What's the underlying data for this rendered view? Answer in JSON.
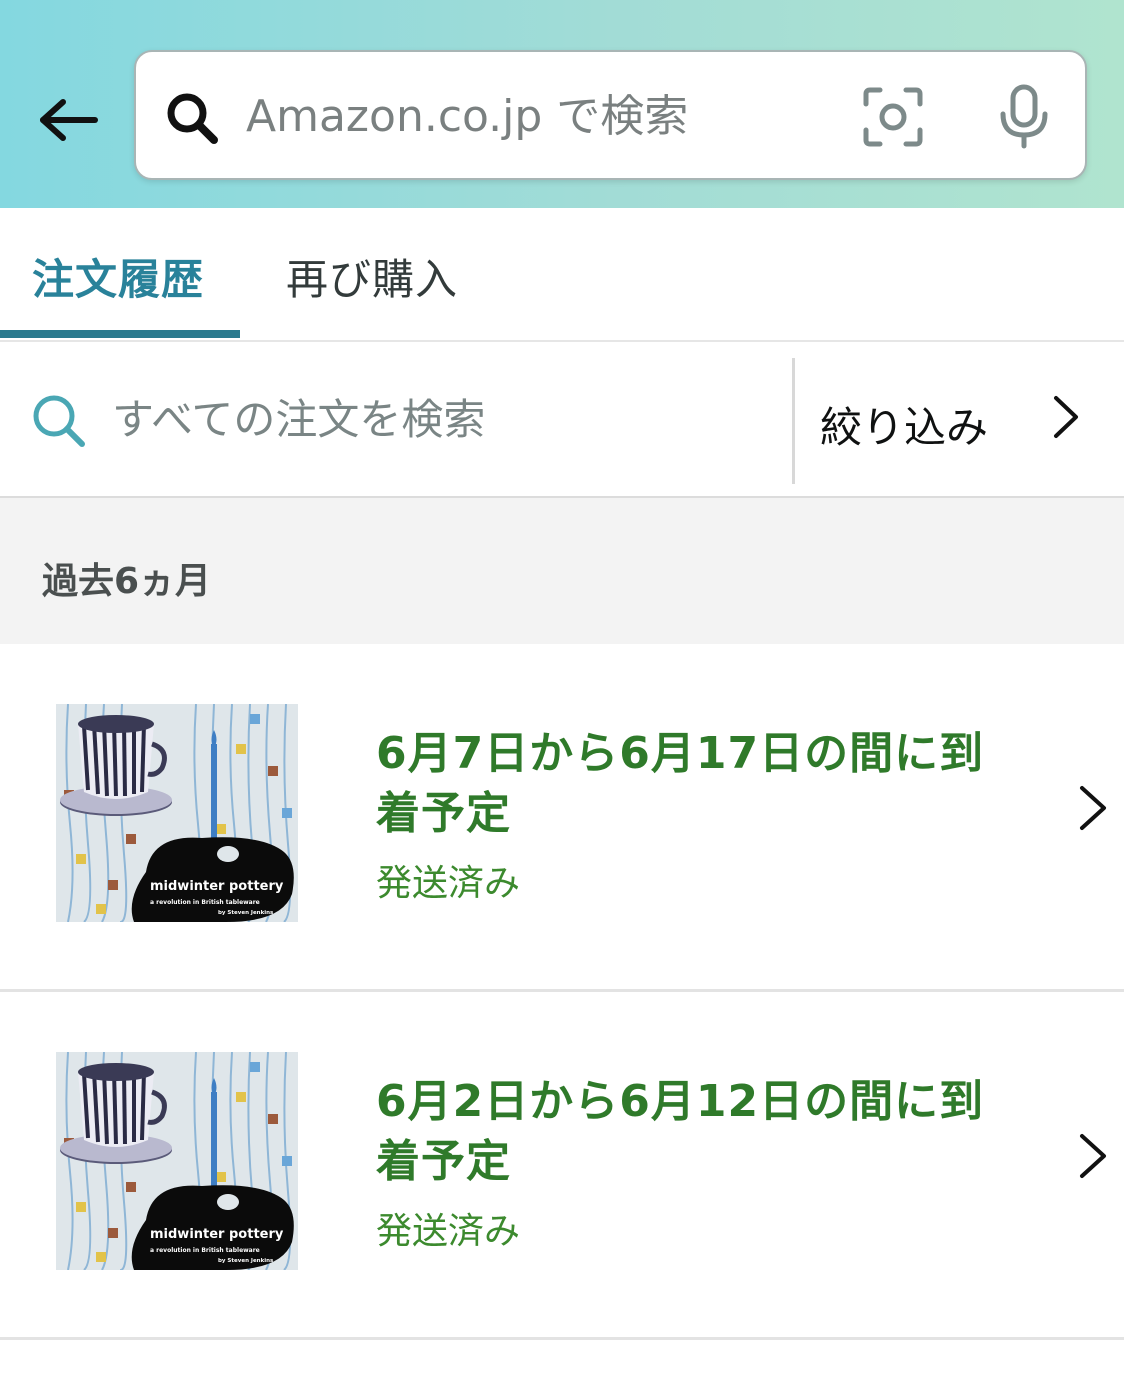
{
  "header": {
    "search_placeholder": "Amazon.co.jp で検索",
    "icons": [
      "back-arrow-icon",
      "search-icon",
      "camera-icon",
      "microphone-icon"
    ]
  },
  "tabs": [
    {
      "label": "注文履歴",
      "active": true
    },
    {
      "label": "再び購入",
      "active": false
    }
  ],
  "order_search": {
    "placeholder": "すべての注文を検索",
    "filter_label": "絞り込み"
  },
  "section": {
    "title": "過去6ヵ月"
  },
  "orders": [
    {
      "arrival": "6月7日から6月17日の間に到着予定",
      "status": "発送済み",
      "book_title": "midwinter pottery",
      "book_subtitle": "a revolution in British tableware",
      "book_author": "by Steven Jenkins"
    },
    {
      "arrival": "6月2日から6月12日の間に到着予定",
      "status": "発送済み",
      "book_title": "midwinter pottery",
      "book_subtitle": "a revolution in British tableware",
      "book_author": "by Steven Jenkins"
    }
  ],
  "colors": {
    "header_gradient_start": "#84d8e0",
    "header_gradient_end": "#b0e4cf",
    "tab_active": "#29829a",
    "delivery_green": "#2f7a2a",
    "section_bg": "#f3f3f3"
  }
}
